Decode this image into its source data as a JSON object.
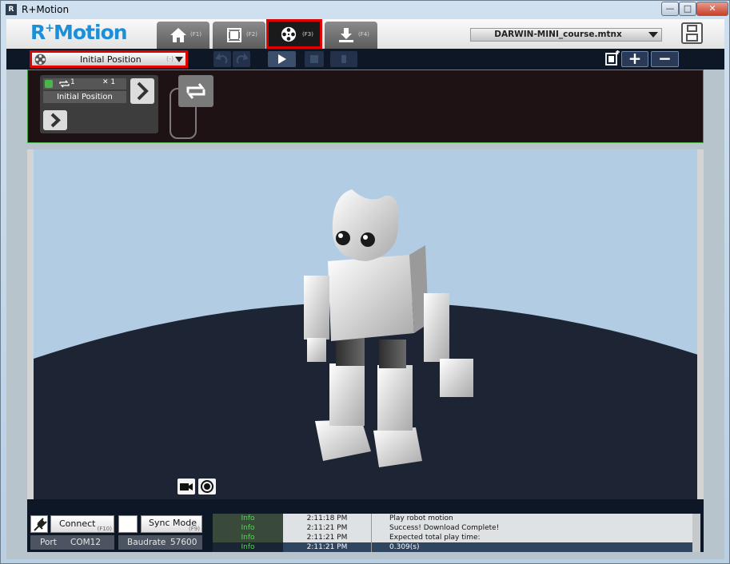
{
  "window": {
    "title": "R+Motion",
    "app_icon": "R"
  },
  "logo": {
    "text": "R",
    "sup": "+",
    "rest": "Motion"
  },
  "nav": {
    "tabs": [
      {
        "icon": "home-icon",
        "key": "(F1)"
      },
      {
        "icon": "film-icon",
        "key": "(F2)"
      },
      {
        "icon": "film-reel-icon",
        "key": "(F3)"
      },
      {
        "icon": "download-icon",
        "key": "(F4)"
      }
    ]
  },
  "file_selector": {
    "value": "DARWIN-MINI_course.mtnx"
  },
  "toolbar": {
    "motion_select": {
      "label": "Initial Position",
      "num": "(-)"
    },
    "plus_label": "+",
    "minus_label": "−"
  },
  "flow": {
    "step": {
      "loop_count": "1",
      "speed": "✕ 1",
      "name": "Initial Position"
    }
  },
  "status": {
    "connect_label": "Connect",
    "connect_key": "(F10)",
    "sync_label": "Sync Mode",
    "sync_key": "(F9)",
    "port_label": "Port",
    "port_value": "COM12",
    "baud_label": "Baudrate",
    "baud_value": "57600"
  },
  "log": [
    {
      "level": "Info",
      "time": "2:11:18 PM",
      "message": "Play robot motion"
    },
    {
      "level": "Info",
      "time": "2:11:21 PM",
      "message": "Success! Download Complete!"
    },
    {
      "level": "Info",
      "time": "2:11:21 PM",
      "message": "Expected total play time:"
    },
    {
      "level": "Info",
      "time": "2:11:21 PM",
      "message": "0.309(s)"
    }
  ],
  "colors": {
    "accent": "#1b8fd8",
    "highlight": "#e00000",
    "dark": "#0d1726",
    "flow_border": "#3fa33f",
    "log_level": "#5cd15c"
  }
}
